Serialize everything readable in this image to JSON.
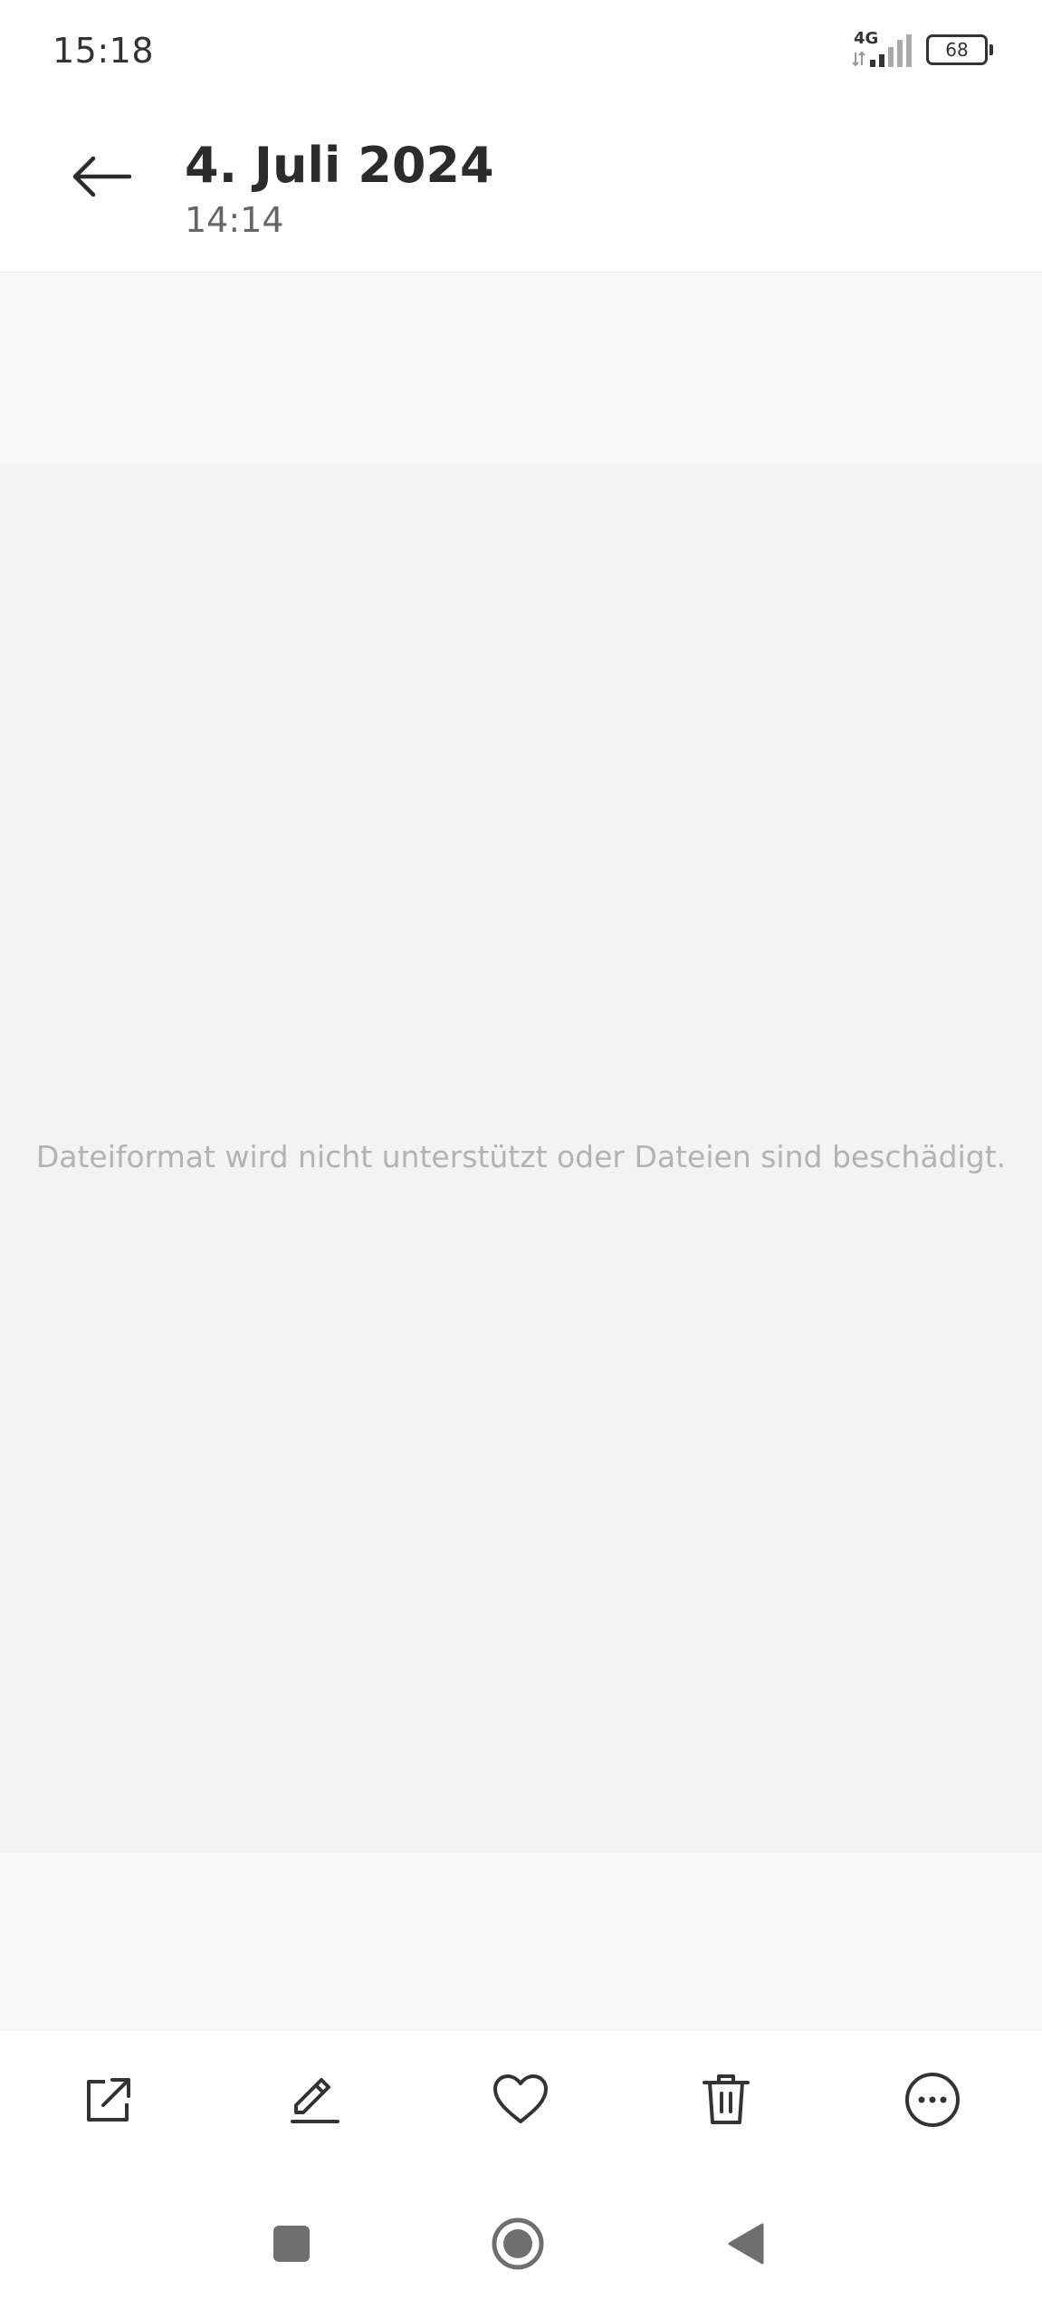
{
  "status_bar": {
    "time": "15:18",
    "network": "4G",
    "battery": "68",
    "icons": [
      "signal-icon",
      "battery-icon"
    ]
  },
  "header": {
    "back_icon": "arrow-left-icon",
    "title": "4. Juli 2024",
    "subtitle": "14:14"
  },
  "viewer": {
    "message": "Dateiformat wird nicht unterstützt oder Dateien sind beschädigt."
  },
  "toolbar": {
    "items": [
      {
        "icon": "share-icon"
      },
      {
        "icon": "edit-icon"
      },
      {
        "icon": "heart-icon"
      },
      {
        "icon": "trash-icon"
      },
      {
        "icon": "more-icon"
      }
    ]
  },
  "navbar": {
    "items": [
      {
        "icon": "recents-square-icon"
      },
      {
        "icon": "home-circle-icon"
      },
      {
        "icon": "back-triangle-icon"
      }
    ]
  },
  "colors": {
    "text_primary": "#2b2b2b",
    "text_secondary": "#666666",
    "message_text": "#b3b3b3",
    "viewer_bg": "#f3f3f3",
    "band_bg": "#f8f8f8"
  }
}
